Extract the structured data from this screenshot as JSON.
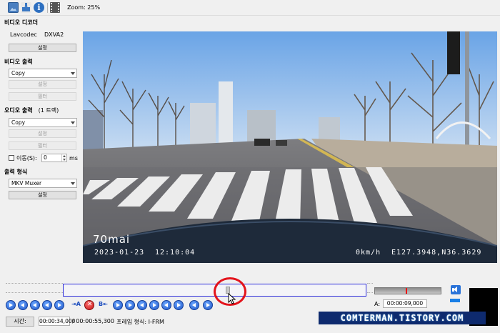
{
  "toolbar": {
    "zoom_label": "Zoom: 25%",
    "icons": [
      "open-image-icon",
      "save-icon",
      "info-icon",
      "film-strip-icon"
    ]
  },
  "left_panel": {
    "video_decoder": {
      "title": "비디오 디코더",
      "key": "Lavcodec",
      "value": "DXVA2",
      "config_button": "설정"
    },
    "video_output": {
      "title": "비디오 출력",
      "codec": "Copy",
      "config_button": "설정",
      "filter_button": "필터"
    },
    "audio_output": {
      "title": "오디오 출력",
      "track": "(1 트랙)",
      "codec": "Copy",
      "config_button": "설정",
      "filter_button": "필터",
      "shift_label": "이동(S):",
      "shift_value": "0",
      "shift_unit": "ms"
    },
    "output_format": {
      "title": "출력 형식",
      "muxer": "MKV Muxer",
      "config_button": "설정"
    }
  },
  "video": {
    "brand": "70mai",
    "date": "2023-01-23",
    "time": "12:10:04",
    "speed": "0km/h",
    "gps": "E127.3948,N36.3629"
  },
  "playback": {
    "selection_a_label": "A:",
    "selection_a_time": "00:00:09,000",
    "marker_a": "A",
    "marker_b": "B",
    "position_fraction": 0.545,
    "volume_fraction": 0.48
  },
  "status": {
    "time_label": "시간:",
    "current_time": "00:00:34,000",
    "total_time": "/ 00:00:55,300",
    "frame_type": "프레임 형식: I-FRM"
  },
  "watermark": "COMTERMAN.TISTORY.COM",
  "colors": {
    "timeline_border": "#2d2ddb",
    "highlight": "#e3141c",
    "watermark_bg": "#0e2a6e"
  }
}
